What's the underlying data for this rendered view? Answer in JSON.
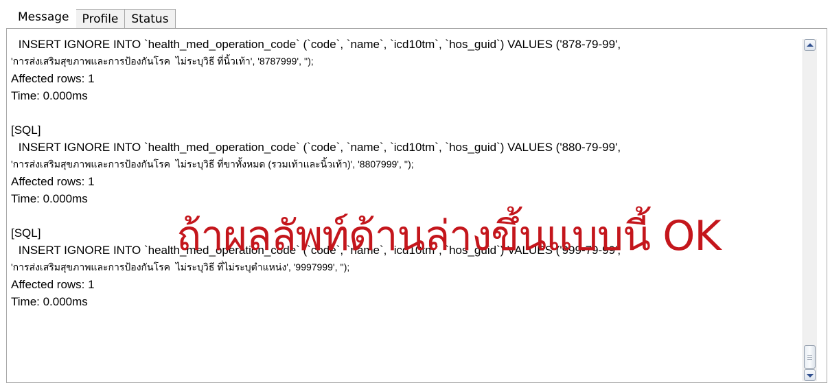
{
  "tabs": [
    {
      "label": "Message",
      "active": true
    },
    {
      "label": "Profile",
      "active": false
    },
    {
      "label": "Status",
      "active": false
    }
  ],
  "log": {
    "entries": [
      {
        "header": "",
        "sql_line1": " INSERT IGNORE INTO `health_med_operation_code` (`code`, `name`, `icd10tm`, `hos_guid`) VALUES ('878-79-99',",
        "sql_line2": "'การส่งเสริมสุขภาพและการป้องกันโรค  ไม่ระบุวิธี ที่นิ้วเท้า', '8787999', '');",
        "affected": "Affected rows: 1",
        "time": "Time: 0.000ms"
      },
      {
        "header": "[SQL]",
        "sql_line1": " INSERT IGNORE INTO `health_med_operation_code` (`code`, `name`, `icd10tm`, `hos_guid`) VALUES ('880-79-99',",
        "sql_line2": "'การส่งเสริมสุขภาพและการป้องกันโรค  ไม่ระบุวิธี ที่ขาทั้งหมด (รวมเท้าและนิ้วเท้า)', '8807999', '');",
        "affected": "Affected rows: 1",
        "time": "Time: 0.000ms"
      },
      {
        "header": "[SQL]",
        "sql_line1": " INSERT IGNORE INTO `health_med_operation_code` (`code`, `name`, `icd10tm`, `hos_guid`) VALUES ('999-79-99',",
        "sql_line2": "'การส่งเสริมสุขภาพและการป้องกันโรค  ไม่ระบุวิธี ที่ไม่ระบุตำแหน่ง', '9997999', '');",
        "affected": "Affected rows: 1",
        "time": "Time: 0.000ms"
      }
    ]
  },
  "overlay": {
    "text": "ถ้าผลลัพท์ด้านล่างขึ้นแบบนี้ OK",
    "color": "#c4161c"
  },
  "scrollbar": {
    "up_icon": "arrow-up-icon",
    "down_icon": "arrow-down-icon"
  }
}
